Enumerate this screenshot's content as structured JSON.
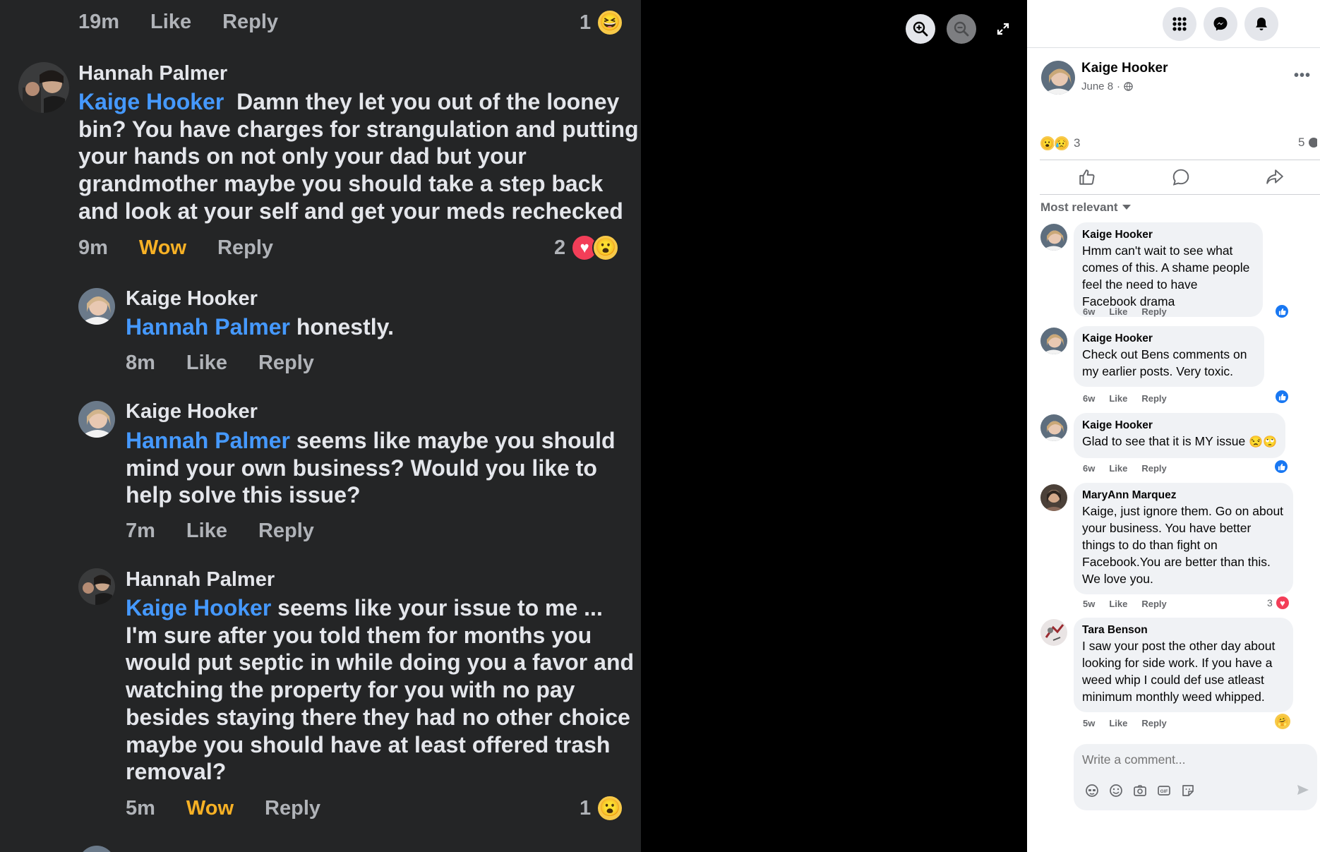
{
  "photo": {
    "top_meta": {
      "time": "19m",
      "like": "Like",
      "reply": "Reply",
      "count": "1"
    },
    "comments": [
      {
        "name": "Hannah Palmer",
        "mention": "Kaige Hooker",
        "line1": "Damn they let you out of the looney",
        "lines": [
          "bin? You have charges for strangulation and putting",
          "your hands on not only your dad but your",
          "grandmother maybe you should take a step back",
          "and look at your self and get your meds rechecked"
        ],
        "time": "9m",
        "reaction": "Wow",
        "reply": "Reply",
        "count": "2"
      },
      {
        "name": "Kaige Hooker",
        "mention": "Hannah Palmer",
        "line1": "honestly.",
        "time": "8m",
        "like": "Like",
        "reply": "Reply"
      },
      {
        "name": "Kaige Hooker",
        "mention": "Hannah Palmer",
        "line1": "seems like maybe you should",
        "lines": [
          "mind your own business? Would you like to",
          "help solve this issue?"
        ],
        "time": "7m",
        "like": "Like",
        "reply": "Reply"
      },
      {
        "name": "Hannah Palmer",
        "mention": "Kaige Hooker",
        "line1": "seems like your issue to me ...",
        "lines": [
          "I'm sure after you told them for months you",
          "would put septic in while doing you a favor and",
          "watching the property for you with no pay",
          "besides staying there they had no other choice",
          "maybe you should have at least offered trash",
          "removal?"
        ],
        "time": "5m",
        "reaction": "Wow",
        "reply": "Reply",
        "count": "1"
      }
    ]
  },
  "post": {
    "author": "Kaige Hooker",
    "date": "June 8",
    "reaction_count": "3",
    "comment_count": "5",
    "sort_label": "Most relevant"
  },
  "comments": [
    {
      "name": "Kaige Hooker",
      "text": "Hmm can't wait to see what comes of this. A shame people feel the need to have Facebook drama",
      "time": "6w",
      "like": "Like",
      "reply": "Reply"
    },
    {
      "name": "Kaige Hooker",
      "text": "Check out Bens comments on my earlier posts. Very toxic.",
      "time": "6w",
      "like": "Like",
      "reply": "Reply"
    },
    {
      "name": "Kaige Hooker",
      "text": "Glad to see that it is MY issue",
      "time": "6w",
      "like": "Like",
      "reply": "Reply"
    },
    {
      "name": "MaryAnn Marquez",
      "text": "Kaige, just ignore them. Go on about your business. You have better things to do than fight on Facebook.You are better than this. We love you.",
      "time": "5w",
      "like": "Like",
      "reply": "Reply",
      "count": "3"
    },
    {
      "name": "Tara Benson",
      "text": "I saw your post the other day about looking for side work. If you have a weed whip I could def use atleast minimum monthly weed whipped.",
      "time": "5w",
      "like": "Like",
      "reply": "Reply"
    }
  ],
  "composer": {
    "placeholder": "Write a comment..."
  },
  "colors": {
    "mention": "#4599ff",
    "wow": "#f7b125",
    "fb_blue": "#1877f2",
    "heart": "#f33e58"
  },
  "icons": [
    "zoom-in-icon",
    "zoom-out-icon",
    "expand-icon",
    "menu-grid-icon",
    "messenger-icon",
    "bell-icon",
    "globe-icon",
    "like-icon",
    "comment-icon",
    "share-icon",
    "caret-down-icon",
    "sticker-icon",
    "emoji-icon",
    "camera-icon",
    "gif-icon",
    "send-icon"
  ]
}
